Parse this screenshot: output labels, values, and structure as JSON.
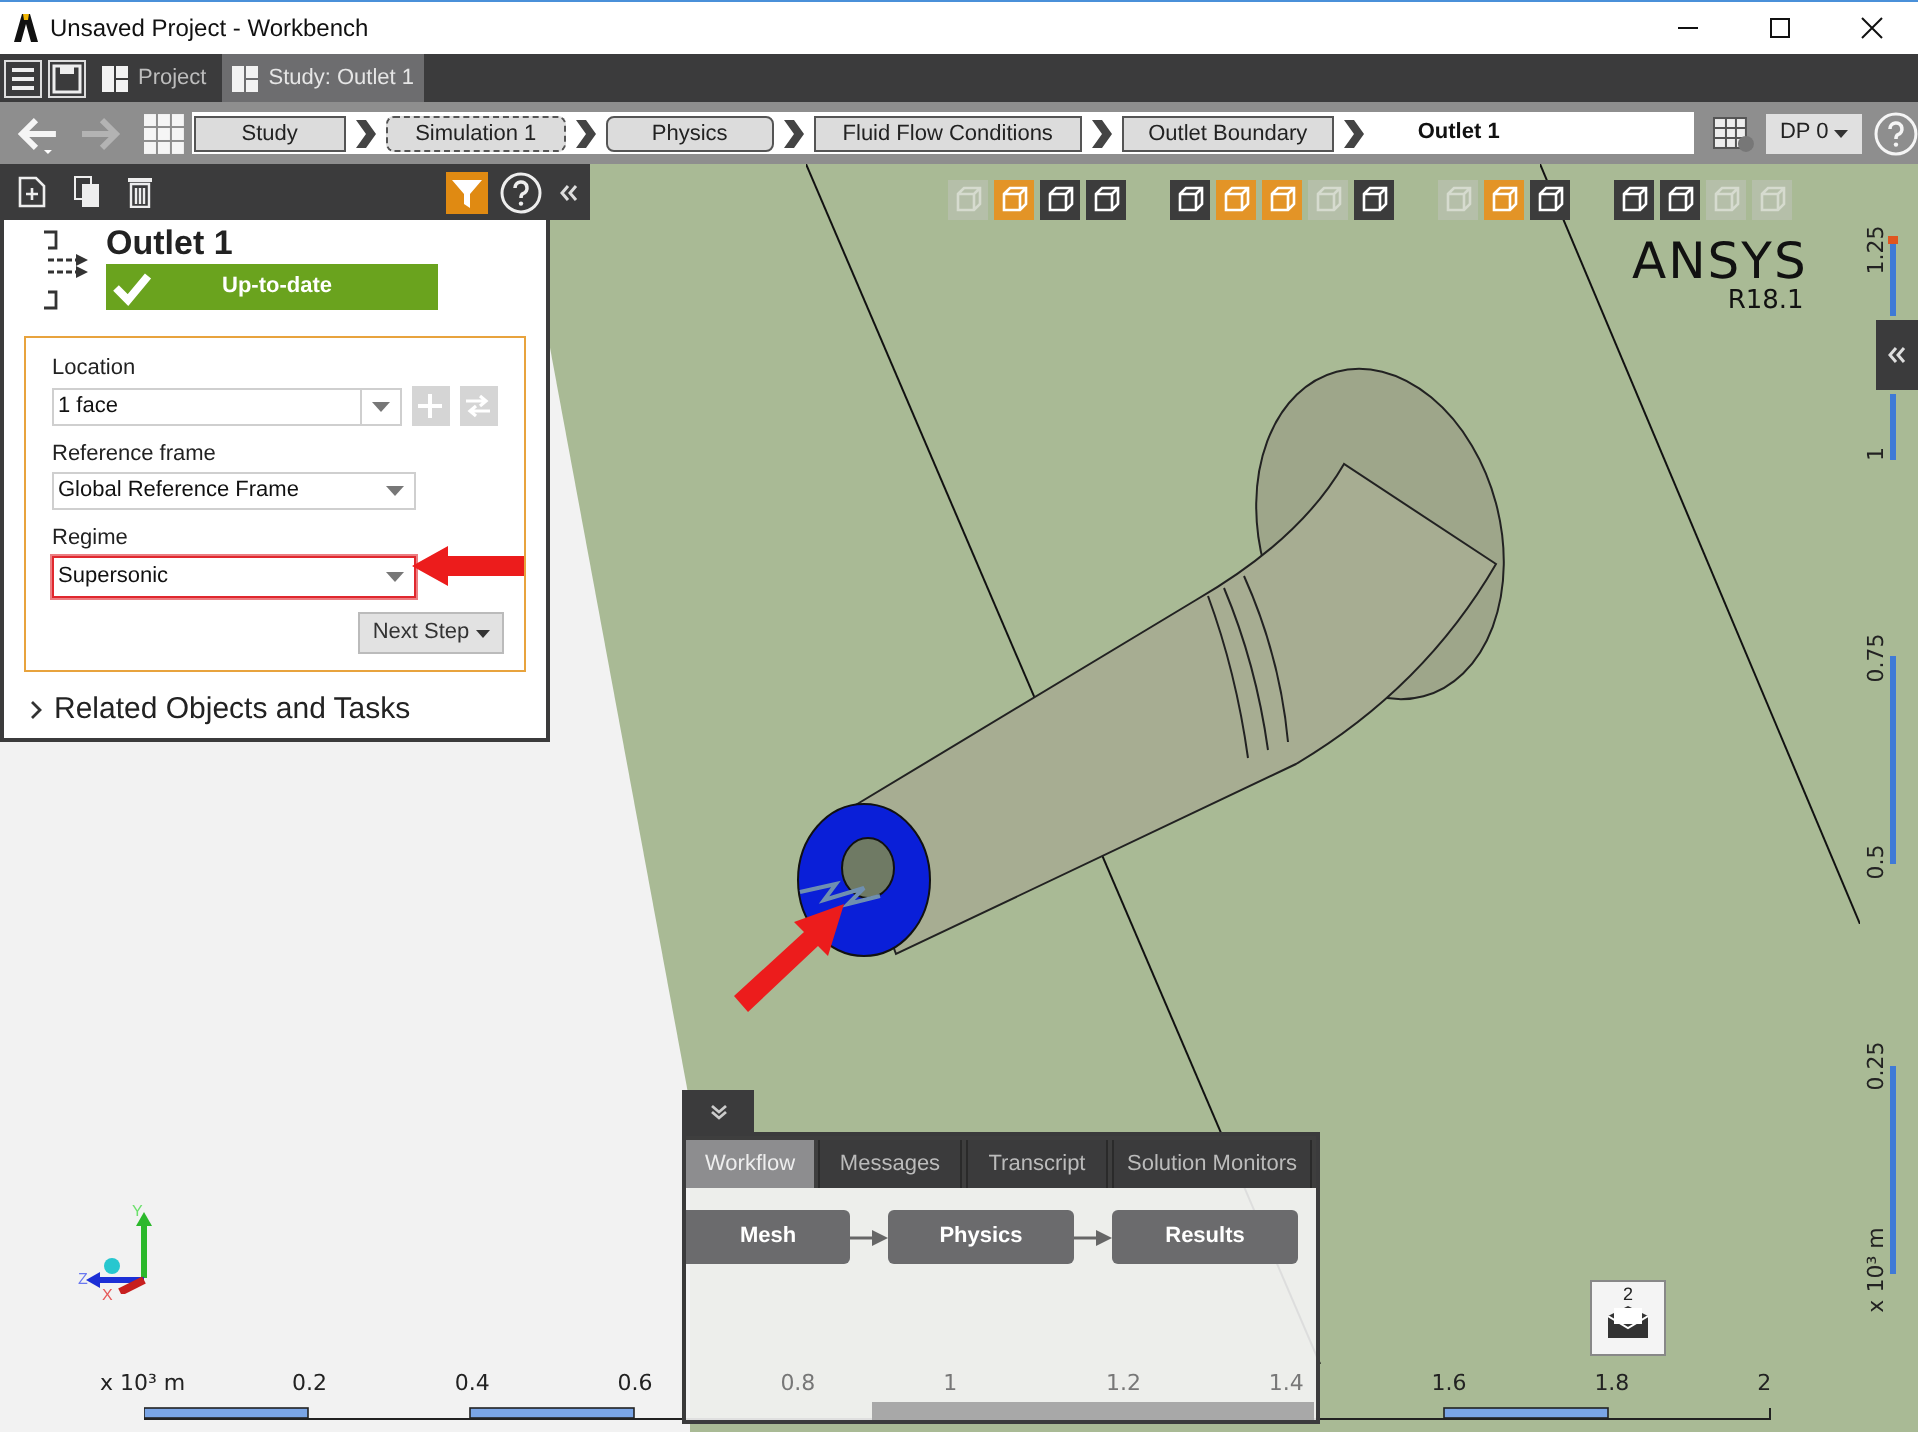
{
  "window": {
    "title": "Unsaved Project - Workbench"
  },
  "tabs": [
    {
      "label": "Project",
      "selected": false
    },
    {
      "label": "Study: Outlet 1",
      "selected": true
    }
  ],
  "nav": {
    "back": {
      "disabled": false
    },
    "forward": {
      "disabled": true
    }
  },
  "breadcrumbs": [
    {
      "label": "Study",
      "kind": "plain"
    },
    {
      "label": "Simulation 1",
      "kind": "dashed"
    },
    {
      "label": "Physics",
      "kind": "rounded"
    },
    {
      "label": "Fluid Flow Conditions",
      "kind": "plain"
    },
    {
      "label": "Outlet Boundary",
      "kind": "plain"
    },
    {
      "label": "Outlet 1",
      "kind": "current"
    }
  ],
  "design_point": {
    "label": "DP 0"
  },
  "panel_toolbar": {
    "filter_on": true
  },
  "properties": {
    "title": "Outlet 1",
    "status": "Up-to-date",
    "fields": [
      {
        "label": "Location",
        "value": "1 face",
        "kind": "location",
        "highlighted": false
      },
      {
        "label": "Reference frame",
        "value": "Global Reference Frame",
        "kind": "select",
        "highlighted": false
      },
      {
        "label": "Regime",
        "value": "Supersonic",
        "kind": "select",
        "highlighted": true
      }
    ],
    "next_button": "Next Step",
    "related": {
      "label": "Related Objects and Tasks",
      "expanded": false
    }
  },
  "view_toolbar": [
    [
      {
        "on": false,
        "disabled": true
      },
      {
        "on": true,
        "disabled": false
      },
      {
        "on": false,
        "disabled": false
      },
      {
        "on": false,
        "disabled": false
      }
    ],
    [
      {
        "on": false,
        "disabled": false
      },
      {
        "on": true,
        "disabled": false
      },
      {
        "on": true,
        "disabled": false
      },
      {
        "on": false,
        "disabled": true
      },
      {
        "on": false,
        "disabled": false
      }
    ],
    [
      {
        "on": false,
        "disabled": true
      },
      {
        "on": true,
        "disabled": false
      },
      {
        "on": false,
        "disabled": false
      }
    ],
    [
      {
        "on": false,
        "disabled": false
      },
      {
        "on": false,
        "disabled": false
      },
      {
        "on": false,
        "disabled": true
      },
      {
        "on": false,
        "disabled": true
      }
    ]
  ],
  "logo": {
    "name": "ANSYS",
    "version": "R18.1"
  },
  "triad": {
    "y": "Y",
    "z": "Z",
    "x": "X"
  },
  "x_axis": {
    "unit": "x 10³ m",
    "ticks": [
      "0.2",
      "0.4",
      "0.6",
      "0.8",
      "1",
      "1.2",
      "1.4",
      "1.6",
      "1.8",
      "2"
    ]
  },
  "y_axis": {
    "unit": "x 10³ m",
    "ticks": [
      "1.25",
      "1",
      "0.75",
      "0.5",
      "0.25"
    ]
  },
  "notifications": {
    "count": "2"
  },
  "bottom_panel": {
    "tabs": [
      {
        "label": "Workflow",
        "selected": true
      },
      {
        "label": "Messages",
        "selected": false
      },
      {
        "label": "Transcript",
        "selected": false
      },
      {
        "label": "Solution Monitors",
        "selected": false
      }
    ],
    "steps": [
      "Mesh",
      "Physics",
      "Results"
    ]
  }
}
